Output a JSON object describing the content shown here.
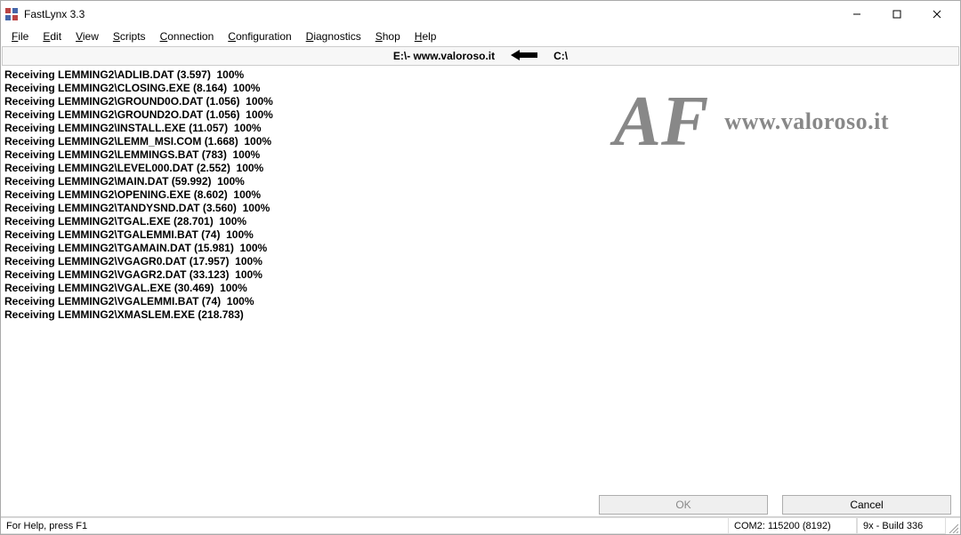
{
  "titlebar": {
    "title": "FastLynx 3.3"
  },
  "menu": {
    "items": [
      {
        "label": "File",
        "hot": "F"
      },
      {
        "label": "Edit",
        "hot": "E"
      },
      {
        "label": "View",
        "hot": "V"
      },
      {
        "label": "Scripts",
        "hot": "S"
      },
      {
        "label": "Connection",
        "hot": "C"
      },
      {
        "label": "Configuration",
        "hot": "C"
      },
      {
        "label": "Diagnostics",
        "hot": "D"
      },
      {
        "label": "Shop",
        "hot": "S"
      },
      {
        "label": "Help",
        "hot": "H"
      }
    ]
  },
  "pathbar": {
    "left": "E:\\- www.valoroso.it",
    "right": "C:\\"
  },
  "log": [
    "Receiving LEMMING2\\ADLIB.DAT (3.597)  100%",
    "Receiving LEMMING2\\CLOSING.EXE (8.164)  100%",
    "Receiving LEMMING2\\GROUND0O.DAT (1.056)  100%",
    "Receiving LEMMING2\\GROUND2O.DAT (1.056)  100%",
    "Receiving LEMMING2\\INSTALL.EXE (11.057)  100%",
    "Receiving LEMMING2\\LEMM_MSI.COM (1.668)  100%",
    "Receiving LEMMING2\\LEMMINGS.BAT (783)  100%",
    "Receiving LEMMING2\\LEVEL000.DAT (2.552)  100%",
    "Receiving LEMMING2\\MAIN.DAT (59.992)  100%",
    "Receiving LEMMING2\\OPENING.EXE (8.602)  100%",
    "Receiving LEMMING2\\TANDYSND.DAT (3.560)  100%",
    "Receiving LEMMING2\\TGAL.EXE (28.701)  100%",
    "Receiving LEMMING2\\TGALEMMI.BAT (74)  100%",
    "Receiving LEMMING2\\TGAMAIN.DAT (15.981)  100%",
    "Receiving LEMMING2\\VGAGR0.DAT (17.957)  100%",
    "Receiving LEMMING2\\VGAGR2.DAT (33.123)  100%",
    "Receiving LEMMING2\\VGAL.EXE (30.469)  100%",
    "Receiving LEMMING2\\VGALEMMI.BAT (74)  100%",
    "Receiving LEMMING2\\XMASLEM.EXE (218.783)"
  ],
  "buttons": {
    "ok": "OK",
    "cancel": "Cancel"
  },
  "status": {
    "help": "For Help, press F1",
    "com": "COM2:  115200  (8192)",
    "build": "9x - Build 336"
  },
  "watermark": {
    "glyph": "AF",
    "text": "www.valoroso.it"
  }
}
